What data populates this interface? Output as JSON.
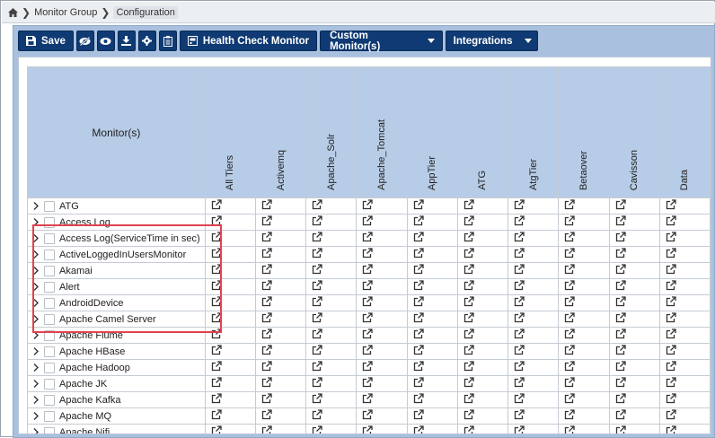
{
  "breadcrumb": {
    "home_icon": "home-icon",
    "items": [
      "Monitor Group",
      "Configuration"
    ]
  },
  "toolbar": {
    "save_label": "Save",
    "health_check_label": "Health Check Monitor",
    "custom_monitor_label": "Custom Monitor(s)",
    "integrations_label": "Integrations",
    "icons": [
      "eye-slash-icon",
      "eye-icon",
      "download-icon",
      "gear-icon",
      "clipboard-icon"
    ]
  },
  "table": {
    "monitor_header": "Monitor(s)",
    "tier_columns": [
      "All Tiers",
      "Activemq",
      "Apache_Solr",
      "Apache_Tomcat",
      "AppTier",
      "ATG",
      "AtgTier",
      "Betaover",
      "Cavisson",
      "Data"
    ],
    "rows": [
      "ATG",
      "Access Log",
      "Access Log(ServiceTime in sec)",
      "ActiveLoggedInUsersMonitor",
      "Akamai",
      "Alert",
      "AndroidDevice",
      "Apache Camel Server",
      "Apache Flume",
      "Apache HBase",
      "Apache Hadoop",
      "Apache JK",
      "Apache Kafka",
      "Apache MQ",
      "Apache Nifi"
    ]
  },
  "colors": {
    "toolbar_button": "#0f3a73",
    "panel_background": "#a9c1de",
    "header_background": "#b7cce6",
    "highlight_border": "#e0434f"
  }
}
